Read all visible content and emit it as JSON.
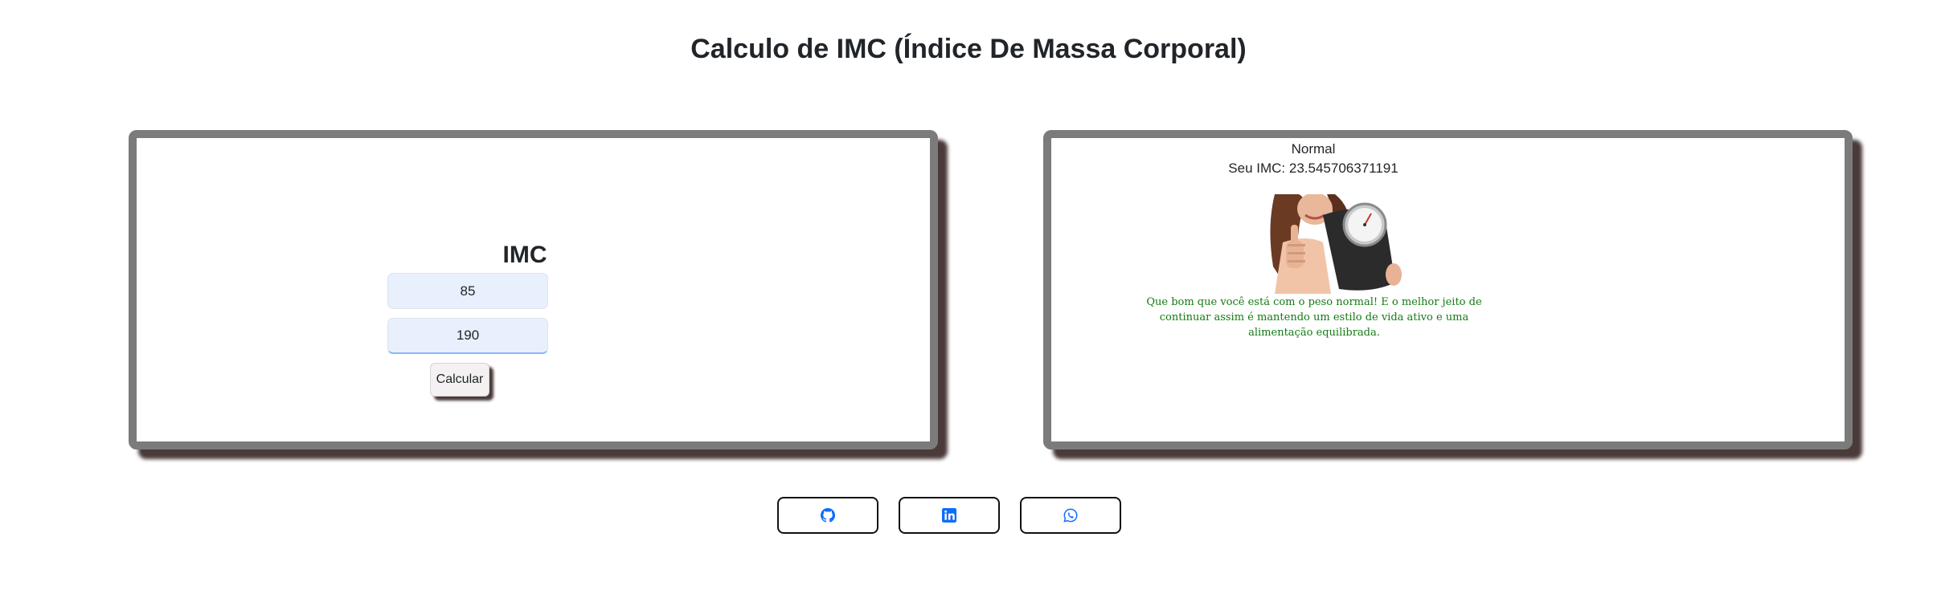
{
  "page": {
    "title": "Calculo de IMC (Índice De Massa Corporal)"
  },
  "form": {
    "heading": "IMC",
    "weight_value": "85",
    "height_value": "190",
    "calculate_label": "Calcular"
  },
  "result": {
    "status": "Normal",
    "imc_line": "Seu IMC: 23.545706371191",
    "message": "Que bom que você está com o peso normal! E o melhor jeito de continuar assim é mantendo um estilo de vida ativo e uma alimentação equilibrada.",
    "image_icon": "woman-holding-scale-image"
  },
  "social": [
    {
      "icon": "github-icon"
    },
    {
      "icon": "linkedin-icon"
    },
    {
      "icon": "whatsapp-icon"
    }
  ],
  "colors": {
    "panel_border": "#7b7b7b",
    "input_background": "#e8f0fe",
    "message_text": "#137a13",
    "social_icon": "#0d6efd"
  }
}
